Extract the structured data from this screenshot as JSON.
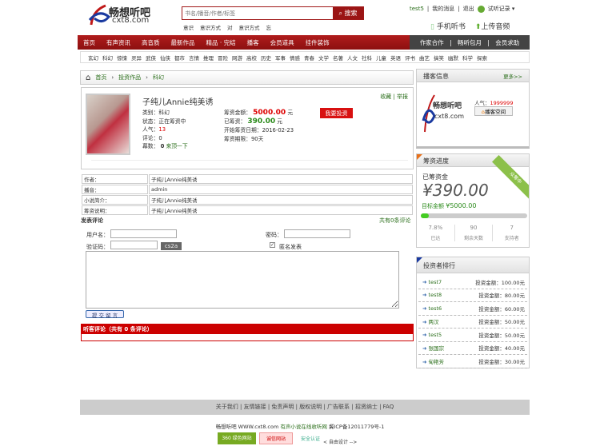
{
  "header": {
    "logo_text": "畅想听吧",
    "logo_domain": "cxt8.com",
    "search_placeholder": "书名/播音/作者/标签",
    "search_button": "搜索",
    "hot_tags": [
      "意识",
      "意识方式",
      "对",
      "意识方式",
      "忘"
    ],
    "user": "test5",
    "my_messages": "我的消息",
    "logout": "退出",
    "history": "试听记录",
    "mobile": "手机听书",
    "upload": "上传音频"
  },
  "nav": {
    "items": [
      "首页",
      "有声资讯",
      "高音质",
      "最新作品",
      "精品 · 完结",
      "播客",
      "会员道具",
      "挂件装饰"
    ],
    "right": [
      "作家合作",
      "畅听包月",
      "会员求助"
    ]
  },
  "categories": [
    "玄幻",
    "科幻",
    "惊悚",
    "灵异",
    "武侠",
    "仙侠",
    "都市",
    "言情",
    "推理",
    "冒险",
    "网游",
    "高校",
    "历史",
    "军事",
    "情感",
    "青春",
    "文学",
    "名著",
    "人文",
    "社科",
    "儿童",
    "英语",
    "评书",
    "曲艺",
    "搞笑",
    "幽默",
    "科学",
    "探索"
  ],
  "breadcrumb": [
    "首页",
    "投资作品",
    "科幻"
  ],
  "work": {
    "title": "子纯儿Annie纯美诱",
    "category": "类别：科幻",
    "status": "状态：正在筹资中",
    "popularity_label": "人气：",
    "popularity": "13",
    "comments": "评论：0",
    "top_label": "幕数：",
    "top_count": "0",
    "top_link": "来顶一下",
    "goal_label": "筹资金额：",
    "goal": "5000.00",
    "yuan": "元",
    "raised_label": "已筹资：",
    "raised": "390.00",
    "start": "开始筹资日期：2016-02-23",
    "period": "筹资期限：90天",
    "invest_button": "我要投资",
    "favorite": "收藏",
    "report": "举报"
  },
  "details": [
    [
      "作者：",
      "子纯儿Annie纯美诱"
    ],
    [
      "播音：",
      "admin"
    ],
    [
      "小说简介：",
      "子纯儿Annie纯美诱"
    ],
    [
      "筹资说明：",
      "子纯儿Annie纯美诱"
    ]
  ],
  "comment_form": {
    "title": "发表评论",
    "count_text": "共有0条评论",
    "username_label": "用户名：",
    "password_label": "密码：",
    "captcha_label": "验证码：",
    "captcha": "cs2a",
    "anonymous": "匿名发表",
    "submit": "提 交 留 言"
  },
  "listener_comments": "听客评论（共有 0 条评论）",
  "podcaster": {
    "title": "播客信息",
    "more": "更多>>",
    "popularity_label": "人气：",
    "popularity": "1999999",
    "space": "播客空间"
  },
  "funding": {
    "title": "筹资进度",
    "raised_label": "已筹资金",
    "raised": "¥390.00",
    "target_label": "目标金额",
    "target": "¥5000.00",
    "badge": "众筹中",
    "progress_percent": 7.8,
    "stats": [
      {
        "value": "7.8%",
        "label": "已达"
      },
      {
        "value": "90",
        "label": "剩余天数"
      },
      {
        "value": "7",
        "label": "支持者"
      }
    ]
  },
  "ranking": {
    "title": "投资者排行",
    "amount_label": "投资金额：",
    "rows": [
      {
        "name": "test7",
        "amount": "100.00元"
      },
      {
        "name": "test8",
        "amount": "80.00元"
      },
      {
        "name": "test6",
        "amount": "60.00元"
      },
      {
        "name": "两汉",
        "amount": "50.00元"
      },
      {
        "name": "test5",
        "amount": "50.00元"
      },
      {
        "name": "张国宗",
        "amount": "40.00元"
      },
      {
        "name": "甸艳芳",
        "amount": "30.00元"
      }
    ]
  },
  "footer": {
    "links": [
      "关于我们",
      "友情链接",
      "免责声明",
      "版权说明",
      "广告联系",
      "招贤纳士",
      "FAQ"
    ],
    "copyright": "畅想听吧 WWW.cxt8.com",
    "slogan": "有声小说在线收听网",
    "icp": "冀ICP备12011779号-1",
    "badge1": "360 绿色网站",
    "badge2": "诚信网站",
    "badge3": "安全认证",
    "design": "< 自由设计 -->"
  },
  "colors": {
    "brand_red": "#a01818",
    "green": "#2a8a1a"
  }
}
